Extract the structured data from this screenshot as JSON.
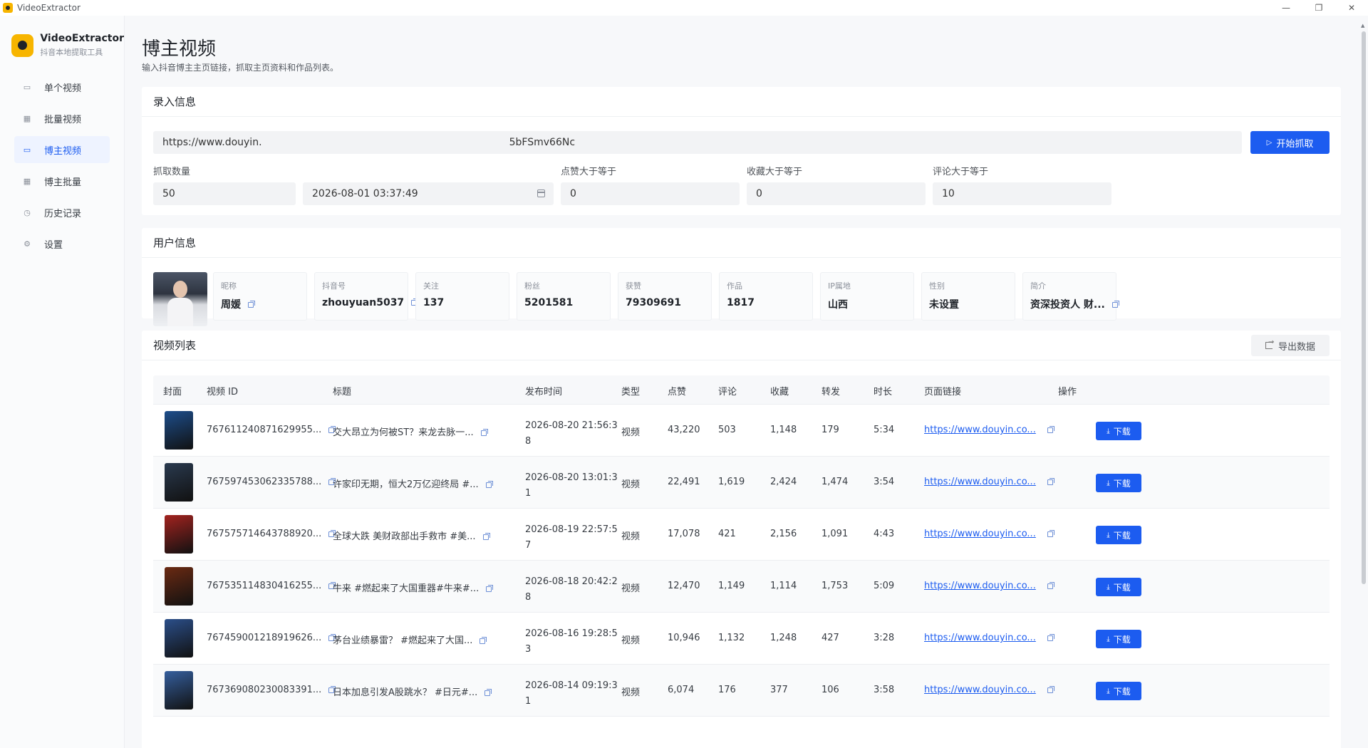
{
  "window": {
    "title": "VideoExtractor",
    "controls": [
      "—",
      "❐",
      "✕"
    ]
  },
  "brand": {
    "name": "VideoExtractor",
    "subtitle": "抖音本地提取工具"
  },
  "nav": [
    {
      "label": "单个视频",
      "icon": "video-icon",
      "glyph": "▭"
    },
    {
      "label": "批量视频",
      "icon": "grid-icon",
      "glyph": "▦"
    },
    {
      "label": "博主视频",
      "icon": "video-camera-icon",
      "glyph": "▭",
      "active": true
    },
    {
      "label": "博主批量",
      "icon": "grid-icon",
      "glyph": "▦"
    },
    {
      "label": "历史记录",
      "icon": "clock-icon",
      "glyph": "◷"
    },
    {
      "label": "设置",
      "icon": "gear-icon",
      "glyph": "⚙"
    }
  ],
  "page": {
    "title": "博主视频",
    "description": "输入抖音博主主页链接，抓取主页资料和作品列表。"
  },
  "input_card": {
    "title": "录入信息",
    "url_value": "https://www.douyin.                                                                              5bFSmv66Nc",
    "start_button": "开始抓取",
    "fields": [
      {
        "label": "抓取数量",
        "value": "50"
      },
      {
        "label": "",
        "value": "2026-08-01 03:37:49"
      },
      {
        "label": "点赞大于等于",
        "value": "0"
      },
      {
        "label": "收藏大于等于",
        "value": "0"
      },
      {
        "label": "评论大于等于",
        "value": "10"
      }
    ]
  },
  "user_card": {
    "title": "用户信息",
    "items": [
      {
        "label": "昵称",
        "value": "周媛",
        "copy": true
      },
      {
        "label": "抖音号",
        "value": "zhouyuan5037",
        "copy": true
      },
      {
        "label": "关注",
        "value": "137"
      },
      {
        "label": "粉丝",
        "value": "5201581"
      },
      {
        "label": "获赞",
        "value": "79309691"
      },
      {
        "label": "作品",
        "value": "1817"
      },
      {
        "label": "IP属地",
        "value": "山西"
      },
      {
        "label": "性别",
        "value": "未设置"
      },
      {
        "label": "简介",
        "value": "资深投资人 财...",
        "copy": true
      }
    ]
  },
  "video_card": {
    "title": "视频列表",
    "export_button": "导出数据",
    "columns": [
      "封面",
      "视频 ID",
      "标题",
      "发布时间",
      "类型",
      "点赞",
      "评论",
      "收藏",
      "转发",
      "时长",
      "页面链接",
      "操作"
    ],
    "download_label": "下载",
    "rows": [
      {
        "id": "767611240871629955...",
        "title": "交大昂立为何被ST？来龙去脉一...",
        "time": "2026-08-20 21:56:38",
        "type": "视频",
        "likes": "43,220",
        "comments": "503",
        "favorites": "1,148",
        "shares": "179",
        "duration": "5:34",
        "link": "https://www.douyin.co...",
        "cover_color": "#1d4e8c"
      },
      {
        "id": "767597453062335788...",
        "title": "许家印无期，恒大2万亿迎终局 #...",
        "time": "2026-08-20 13:01:31",
        "type": "视频",
        "likes": "22,491",
        "comments": "1,619",
        "favorites": "2,424",
        "shares": "1,474",
        "duration": "3:54",
        "link": "https://www.douyin.co...",
        "cover_color": "#2a3a4f"
      },
      {
        "id": "767575714643788920...",
        "title": "全球大跌 美财政部出手救市 #美...",
        "time": "2026-08-19 22:57:57",
        "type": "视频",
        "likes": "17,078",
        "comments": "421",
        "favorites": "2,156",
        "shares": "1,091",
        "duration": "4:43",
        "link": "https://www.douyin.co...",
        "cover_color": "#a3231f"
      },
      {
        "id": "767535114830416255...",
        "title": "牛来 #燃起来了大国重器#牛来#...",
        "time": "2026-08-18 20:42:28",
        "type": "视频",
        "likes": "12,470",
        "comments": "1,149",
        "favorites": "1,114",
        "shares": "1,753",
        "duration": "5:09",
        "link": "https://www.douyin.co...",
        "cover_color": "#6b2a12"
      },
      {
        "id": "767459001218919626...",
        "title": "茅台业绩暴雷？ #燃起来了大国...",
        "time": "2026-08-16 19:28:53",
        "type": "视频",
        "likes": "10,946",
        "comments": "1,132",
        "favorites": "1,248",
        "shares": "427",
        "duration": "3:28",
        "link": "https://www.douyin.co...",
        "cover_color": "#2b4f8a"
      },
      {
        "id": "767369080230083391...",
        "title": "日本加息引发A股跳水？ #日元#...",
        "time": "2026-08-14 09:19:31",
        "type": "视频",
        "likes": "6,074",
        "comments": "176",
        "favorites": "377",
        "shares": "106",
        "duration": "3:58",
        "link": "https://www.douyin.co...",
        "cover_color": "#355f9e"
      }
    ]
  }
}
